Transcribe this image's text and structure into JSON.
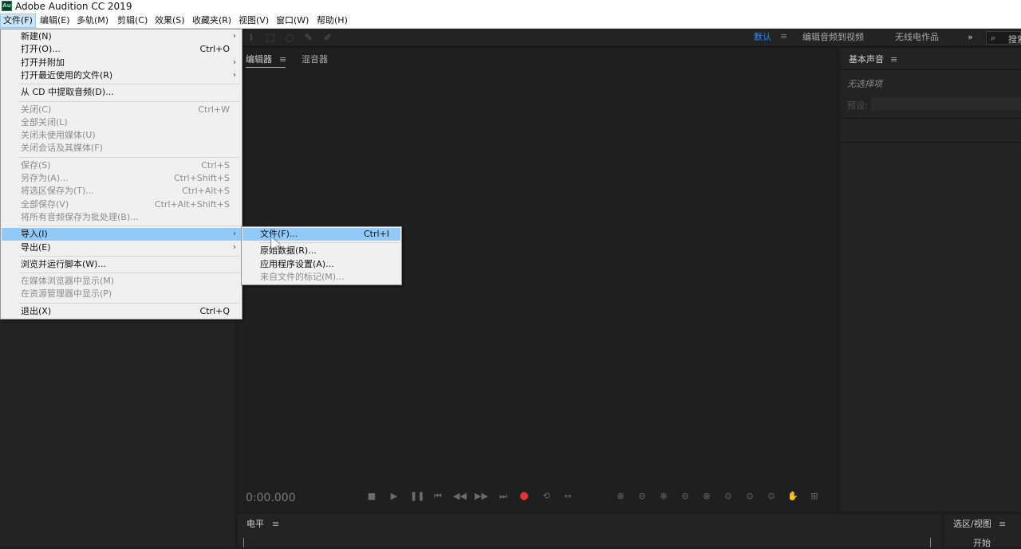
{
  "app": {
    "title": "Adobe Audition CC 2019",
    "icon": "Au"
  },
  "menubar": [
    {
      "label": "文件(F)",
      "active": true
    },
    {
      "label": "编辑(E)"
    },
    {
      "label": "多轨(M)"
    },
    {
      "label": "剪辑(C)"
    },
    {
      "label": "效果(S)"
    },
    {
      "label": "收藏夹(R)"
    },
    {
      "label": "视图(V)"
    },
    {
      "label": "窗口(W)"
    },
    {
      "label": "帮助(H)"
    }
  ],
  "workspaces": {
    "items": [
      "默认",
      "编辑音频到视频",
      "无线电作品"
    ],
    "more": "»",
    "menu_icon": "≡"
  },
  "search": {
    "label": "搜索"
  },
  "editor_panel": {
    "tabs": [
      "编辑器",
      "混音器"
    ],
    "time": "0:00.000"
  },
  "essential_sound": {
    "title": "基本声音",
    "no_selection": "无选择项",
    "preset_label": "预设:"
  },
  "level_panel": {
    "title": "电平"
  },
  "selection_panel": {
    "title": "选区/视图",
    "start_label": "开始"
  },
  "file_menu": [
    {
      "label": "新建(N)",
      "submenu": true
    },
    {
      "label": "打开(O)...",
      "shortcut": "Ctrl+O"
    },
    {
      "label": "打开并附加",
      "submenu": true
    },
    {
      "label": "打开最近使用的文件(R)",
      "submenu": true
    },
    {
      "separator": true
    },
    {
      "label": "从 CD 中提取音频(D)..."
    },
    {
      "separator": true
    },
    {
      "label": "关闭(C)",
      "shortcut": "Ctrl+W",
      "disabled": true
    },
    {
      "label": "全部关闭(L)",
      "disabled": true
    },
    {
      "label": "关闭未使用媒体(U)",
      "disabled": true
    },
    {
      "label": "关闭会话及其媒体(F)",
      "disabled": true
    },
    {
      "separator": true
    },
    {
      "label": "保存(S)",
      "shortcut": "Ctrl+S",
      "disabled": true
    },
    {
      "label": "另存为(A)...",
      "shortcut": "Ctrl+Shift+S",
      "disabled": true
    },
    {
      "label": "将选区保存为(T)...",
      "shortcut": "Ctrl+Alt+S",
      "disabled": true
    },
    {
      "label": "全部保存(V)",
      "shortcut": "Ctrl+Alt+Shift+S",
      "disabled": true
    },
    {
      "label": "将所有音频保存为批处理(B)...",
      "disabled": true
    },
    {
      "separator": true
    },
    {
      "label": "导入(I)",
      "submenu": true,
      "highlighted": true
    },
    {
      "label": "导出(E)",
      "submenu": true
    },
    {
      "separator": true
    },
    {
      "label": "浏览并运行脚本(W)..."
    },
    {
      "separator": true
    },
    {
      "label": "在媒体浏览器中显示(M)",
      "disabled": true
    },
    {
      "label": "在资源管理器中显示(P)",
      "disabled": true
    },
    {
      "separator": true
    },
    {
      "label": "退出(X)",
      "shortcut": "Ctrl+Q"
    }
  ],
  "import_submenu": [
    {
      "label": "文件(F)...",
      "shortcut": "Ctrl+I",
      "highlighted": true
    },
    {
      "separator": true
    },
    {
      "label": "原始数据(R)..."
    },
    {
      "label": "应用程序设置(A)..."
    },
    {
      "label": "来自文件的标记(M)...",
      "disabled": true
    }
  ],
  "colors": {
    "accent": "#2d8ceb",
    "record": "#e5333a",
    "menu_highlight": "#91c9f7"
  }
}
